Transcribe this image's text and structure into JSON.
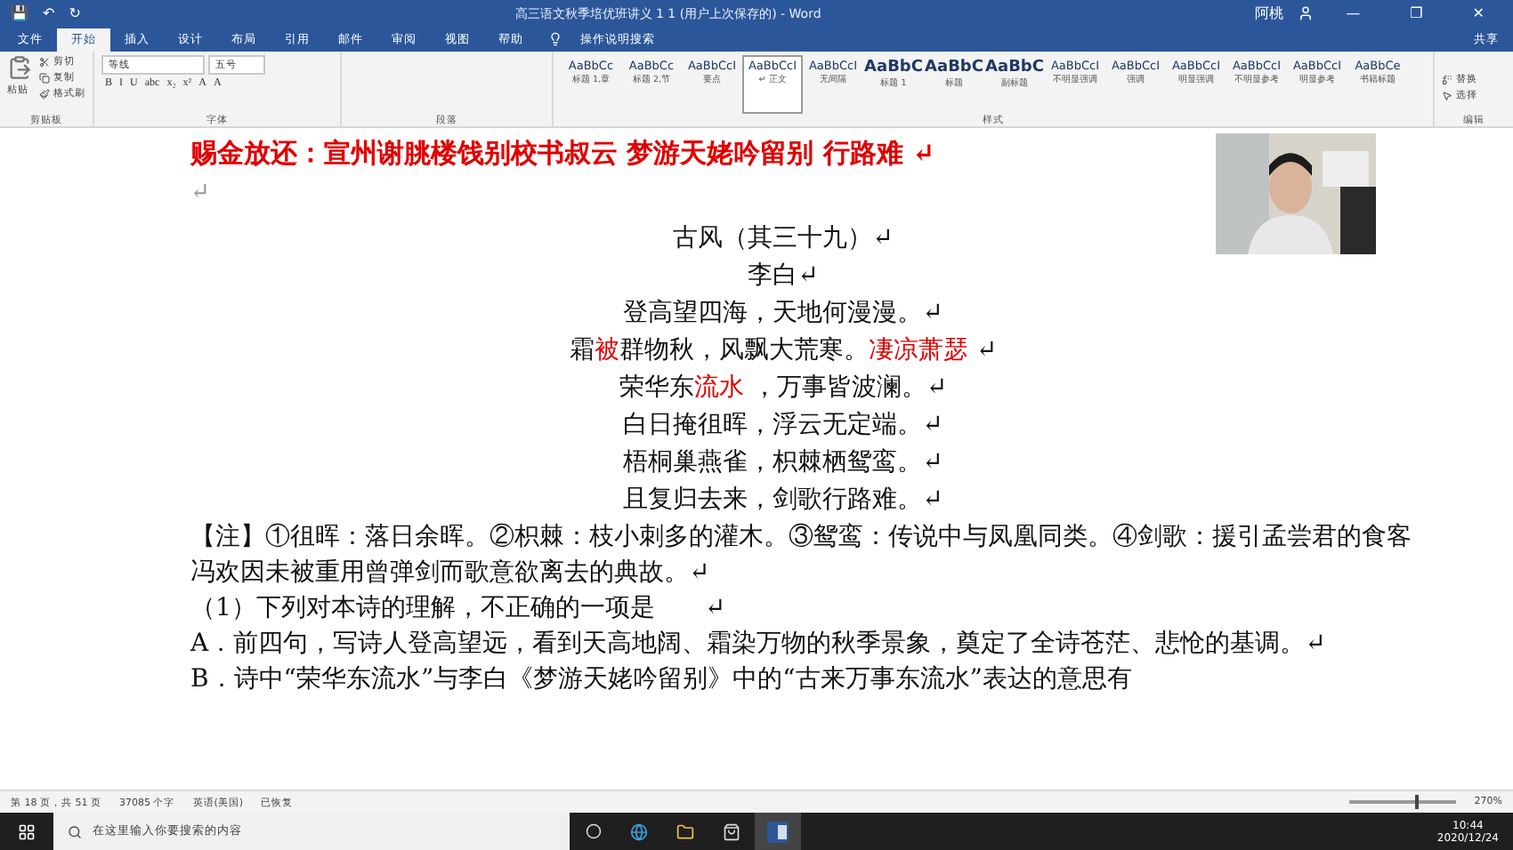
{
  "window": {
    "title": "高三语文秋季培优班讲义 1 1 (用户上次保存的) - Word",
    "user": "阿桃",
    "controls": [
      "—",
      "❐",
      "✕"
    ],
    "share": "共享"
  },
  "quick_access": [
    "💾",
    "↶",
    "↻"
  ],
  "tabs": [
    {
      "label": "文件",
      "selected": false
    },
    {
      "label": "开始",
      "selected": true
    },
    {
      "label": "插入",
      "selected": false
    },
    {
      "label": "设计",
      "selected": false
    },
    {
      "label": "布局",
      "selected": false
    },
    {
      "label": "引用",
      "selected": false
    },
    {
      "label": "邮件",
      "selected": false
    },
    {
      "label": "审阅",
      "selected": false
    },
    {
      "label": "视图",
      "selected": false
    },
    {
      "label": "帮助",
      "selected": false
    }
  ],
  "tell_me": "操作说明搜索",
  "clipboard": {
    "paste": "粘贴",
    "items": [
      "剪切",
      "复制",
      "格式刷"
    ],
    "label": "剪贴板"
  },
  "font": {
    "name": "等线",
    "size": "五号",
    "buttons": [
      "B",
      "I",
      "U",
      "abc",
      "x₂",
      "x²",
      "A",
      "A"
    ],
    "label": "字体"
  },
  "paragraph": {
    "label": "段落"
  },
  "styles": {
    "label": "样式",
    "items": [
      {
        "sample": "AaBbCc",
        "name": "标题 1,章",
        "selected": false
      },
      {
        "sample": "AaBbCc",
        "name": "标题 2,节",
        "selected": false
      },
      {
        "sample": "AaBbCcI",
        "name": "要点",
        "selected": false
      },
      {
        "sample": "AaBbCcI",
        "name": "↵ 正文",
        "selected": true
      },
      {
        "sample": "AaBbCcI",
        "name": "无间隔",
        "selected": false
      },
      {
        "sample": "AaBbC",
        "name": "标题 1",
        "selected": false
      },
      {
        "sample": "AaBbC",
        "name": "标题",
        "selected": false
      },
      {
        "sample": "AaBbC",
        "name": "副标题",
        "selected": false
      },
      {
        "sample": "AaBbCcI",
        "name": "不明显强调",
        "selected": false
      },
      {
        "sample": "AaBbCcI",
        "name": "强调",
        "selected": false
      },
      {
        "sample": "AaBbCcI",
        "name": "明显强调",
        "selected": false
      },
      {
        "sample": "AaBbCcI",
        "name": "不明显参考",
        "selected": false
      },
      {
        "sample": "AaBbCcI",
        "name": "明显参考",
        "selected": false
      },
      {
        "sample": "AaBbCe",
        "name": "书籍标题",
        "selected": false
      }
    ]
  },
  "editing": {
    "items": [
      "替换",
      "选择"
    ],
    "label": "编辑"
  },
  "document": {
    "heading": "赐金放还：宣州谢朓楼饯别校书叔云  梦游天姥吟留别  行路难 ↵",
    "blank": "↵",
    "poem": [
      [
        {
          "text": "古风（其三十九）↵",
          "red": false
        }
      ],
      [
        {
          "text": "李白↵",
          "red": false
        }
      ],
      [
        {
          "text": "登高望四海，天地何漫漫。↵",
          "red": false
        }
      ],
      [
        {
          "text": "霜",
          "red": false
        },
        {
          "text": "被",
          "red": true
        },
        {
          "text": "群物秋，风飘大荒寒。",
          "red": false
        },
        {
          "text": "凄凉萧瑟",
          "red": true
        },
        {
          "text": " ↵",
          "red": false
        }
      ],
      [
        {
          "text": "荣华东",
          "red": false
        },
        {
          "text": "流水",
          "red": true
        },
        {
          "text": " ，万事皆波澜。↵",
          "red": false
        }
      ],
      [
        {
          "text": "白日掩徂晖，浮云无定端。↵",
          "red": false
        }
      ],
      [
        {
          "text": "梧桐巢燕雀，枳棘栖鸳鸾。↵",
          "red": false
        }
      ],
      [
        {
          "text": "且复归去来，剑歌行路难。↵",
          "red": false
        }
      ]
    ],
    "paragraphs": [
      "【注】①徂晖：落日余晖。②枳棘：枝小刺多的灌木。③鸳鸾：传说中与凤凰同类。④剑歌：援引孟尝君的食客冯欢因未被重用曾弹剑而歌意欲离去的典故。↵",
      "（1）下列对本诗的理解，不正确的一项是　　↵",
      "A．前四句，写诗人登高望远，看到天高地阔、霜染万物的秋季景象，奠定了全诗苍茫、悲怆的基调。↵",
      "B．诗中“荣华东流水”与李白《梦游天姥吟留别》中的“古来万事东流水”表达的意思有"
    ]
  },
  "webcam": {
    "kind": "picture"
  },
  "status_bar": {
    "page": "第 18 页，共 51 页",
    "words": "37085 个字",
    "language": "英语(美国)",
    "state": "已恢复",
    "zoom": "270%",
    "level": 0.62
  },
  "taskbar": {
    "search": "在这里输入你要搜索的内容",
    "time": "10:44",
    "date": "2020/12/24"
  }
}
